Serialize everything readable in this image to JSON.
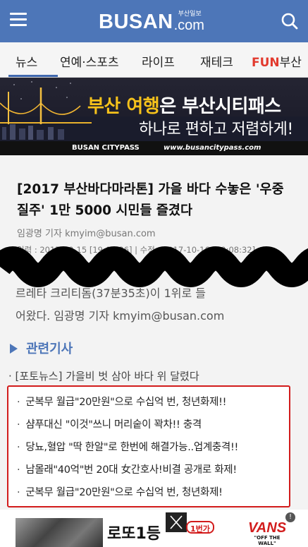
{
  "header": {
    "logo_main": "BUSAN",
    "logo_kor": "부산일보",
    "logo_com": ".com"
  },
  "nav": {
    "tabs": [
      {
        "label": "뉴스"
      },
      {
        "label": "연예·스포츠"
      },
      {
        "label": "라이프"
      },
      {
        "label": "재테크"
      }
    ],
    "fun_tab": {
      "fun": "FUN",
      "rest": "부산"
    }
  },
  "banner": {
    "title_highlight": "부산 여행",
    "title_rest": "은 부산시티패스",
    "subtitle": "하나로 편하고 저렴하게!",
    "brand": "BUSAN CITYPASS",
    "url": "www.busancitypass.com"
  },
  "article": {
    "headline": "[2017 부산바다마라톤] 가을 바다 수놓은 '우중 질주' 1만 5000 시민들 즐겼다",
    "byline": "임광명 기자 kmyim@busan.com",
    "dates": "입력 : 2017-10-15 [19:09:36] | 수정 : 2017-10-16 [00:08:32]",
    "body_line1": "르레타 크리티돔(37분35초)이 1위로 들",
    "body_line2": "어왔다. 임광명 기자 kmyim@busan.com"
  },
  "related": {
    "heading": "관련기사",
    "items": [
      {
        "text": "· [포토뉴스] 가을비 벗 삼아 바다 위 달렸다"
      }
    ]
  },
  "ad_links": [
    {
      "text": "군복무 월급\"20만원\"으로 수십억 번, 청년화제!!"
    },
    {
      "text": "샴푸대신 \"이것\"쓰니 머리숱이 꽉차!! 충격"
    },
    {
      "text": "당뇨,혈압 \"딱 한알\"로 한번에 해결가능..업계충격!!"
    },
    {
      "text": "남몰래\"40억\"번 20대 女간호사!비결 공개로 화제!"
    },
    {
      "text": "군복무 월급\"20만원\"으로 수십억 번, 청년화제!"
    }
  ],
  "bottom_ad": {
    "title": "로또1등",
    "tag": "1번가",
    "brand": "VANS",
    "brand_sub": "\"OFF THE WALL\"",
    "info": "!"
  },
  "colors": {
    "header_bg": "#4d76b8",
    "nav_active_underline": "#3f68ae",
    "banner_highlight": "#f6c21b",
    "ad_border": "#d21c1c",
    "related_heading": "#4d76b8",
    "fun_accent": "#e23a2e"
  },
  "icons": {
    "menu": "hamburger-menu-icon",
    "search": "search-icon",
    "related": "triangle-right-icon",
    "close": "close-icon",
    "info": "info-icon"
  }
}
